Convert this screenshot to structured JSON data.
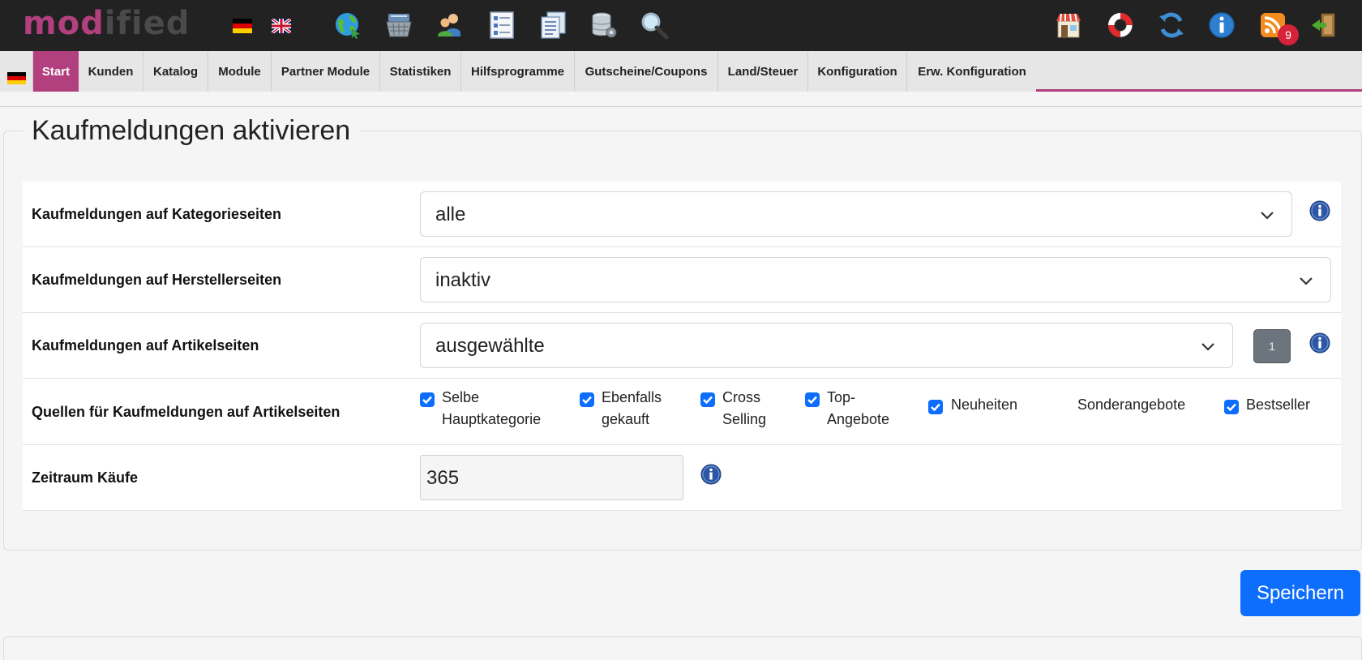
{
  "header": {
    "logo_text": "modified",
    "logo_part1": "mod",
    "logo_part2": "ified",
    "language_flags": [
      "german-flag-icon",
      "uk-flag-icon"
    ],
    "tool_icons": [
      "globe-icon",
      "basket-icon",
      "customers-icon",
      "checklist-icon",
      "documents-icon",
      "database-settings-icon",
      "search-icon"
    ],
    "right_icons": [
      "shop-icon",
      "lifebuoy-icon",
      "refresh-icon",
      "info-icon",
      "rss-icon",
      "logout-icon"
    ],
    "rss_badge_count": "9"
  },
  "nav": {
    "items": [
      "Start",
      "Kunden",
      "Katalog",
      "Module",
      "Partner Module",
      "Statistiken",
      "Hilfsprogramme",
      "Gutscheine/Coupons",
      "Land/Steuer",
      "Konfiguration",
      "Erw. Konfiguration"
    ],
    "active": "Start"
  },
  "form": {
    "title": "Kaufmeldungen aktivieren",
    "rows": [
      {
        "label": "Kaufmeldungen auf Kategorieseiten",
        "value": "alle"
      },
      {
        "label": "Kaufmeldungen auf Herstellerseiten",
        "value": "inaktiv"
      },
      {
        "label": "Kaufmeldungen auf Artikelseiten",
        "value": "ausgewählte",
        "count_button": "1"
      },
      {
        "label": "Quellen für Kaufmeldungen auf Artikelseiten",
        "options": [
          {
            "label": "Selbe\nHauptkategorie",
            "checked": true
          },
          {
            "label": "Ebenfalls\ngekauft",
            "checked": true
          },
          {
            "label": "Cross\nSelling",
            "checked": true
          },
          {
            "label": "Top-\nAngebote",
            "checked": true
          },
          {
            "label": "Neuheiten",
            "checked": true
          },
          {
            "label": "Sonderangebote",
            "checked": false
          },
          {
            "label": "Bestseller",
            "checked": true
          }
        ]
      },
      {
        "label": "Zeitraum Käufe",
        "value": "365"
      }
    ],
    "save_label": "Speichern"
  },
  "colors": {
    "topbar": "#222222",
    "accent": "#b2407e",
    "primary": "#0d6efd",
    "badge": "#d5213a",
    "nav_bg": "#e6e6e6"
  }
}
